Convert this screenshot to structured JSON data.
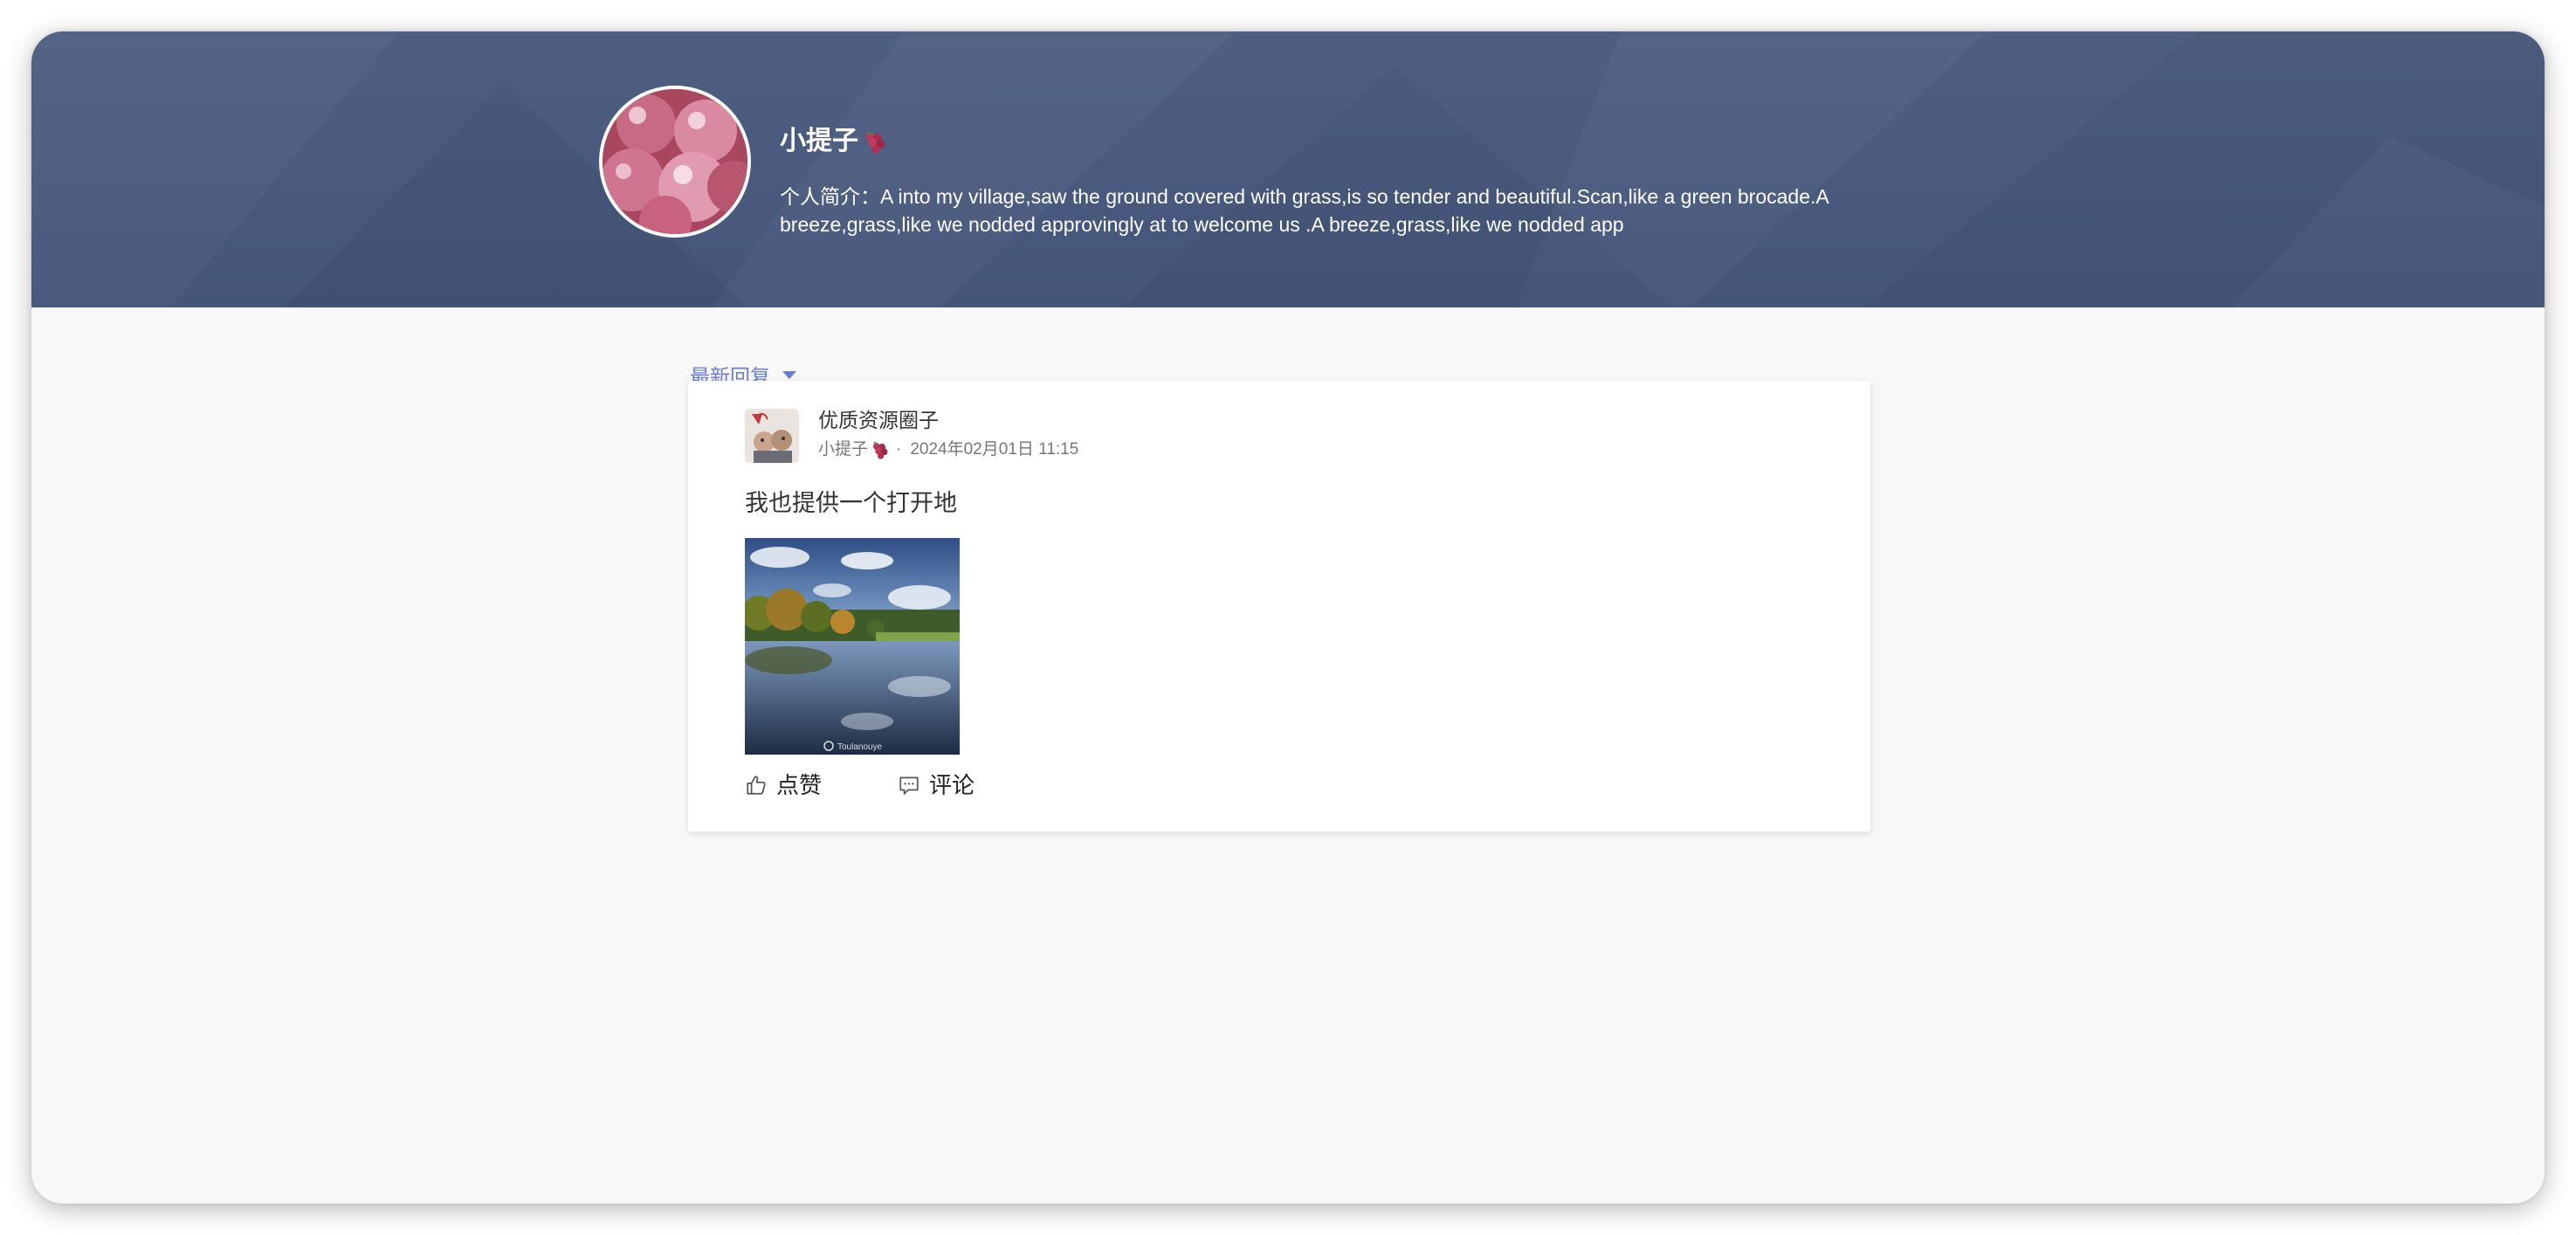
{
  "profile": {
    "name": "小提子",
    "bio": "个人简介：A into my village,saw the ground covered with grass,is so tender and beautiful.Scan,like a green brocade.A breeze,grass,like we nodded approvingly at to welcome us  .A breeze,grass,like we nodded app"
  },
  "sort": {
    "selected": "最新回复"
  },
  "post": {
    "circle": "优质资源圈子",
    "author": "小提子",
    "date": "2024年02月01日 11:15",
    "text": "我也提供一个打开地",
    "image_watermark": "Toulanouye",
    "like_label": "点赞",
    "comment_label": "评论"
  },
  "icons": {
    "grape": "grape-emoji-icon",
    "sort_caret": "caret-down-icon",
    "like": "thumbs-up-icon",
    "comment": "comment-bubble-icon"
  },
  "colors": {
    "banner": "#4a5a7e",
    "accent": "#6b7cd4",
    "page_bg": "#f8f8f8"
  }
}
